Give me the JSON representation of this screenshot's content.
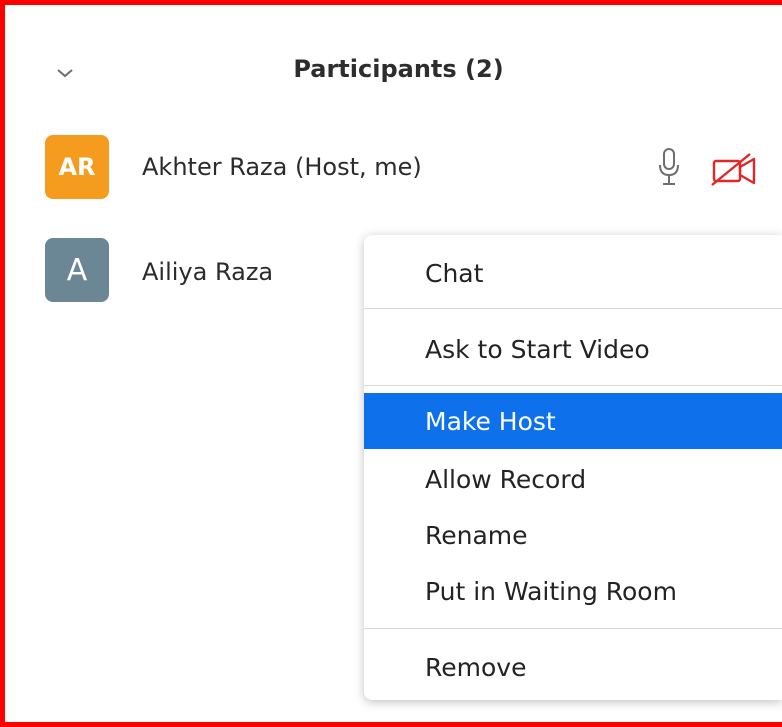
{
  "panel": {
    "title": "Participants (2)"
  },
  "participants": [
    {
      "initials": "AR",
      "name": "Akhter Raza (Host, me)",
      "avatar_color": "#f59c1e",
      "mic": "mic-icon",
      "video": "video-off-icon"
    },
    {
      "initials": "A",
      "name": "Ailiya Raza",
      "avatar_color": "#6b8695"
    }
  ],
  "context_menu": {
    "items": [
      "Chat",
      "Ask to Start Video",
      "Make Host",
      "Allow Record",
      "Rename",
      "Put in Waiting Room",
      "Remove"
    ],
    "highlighted": "Make Host",
    "highlight_color": "#0e71eb"
  },
  "colors": {
    "frame_border": "#ff0000",
    "video_off_icon": "#e02828"
  }
}
